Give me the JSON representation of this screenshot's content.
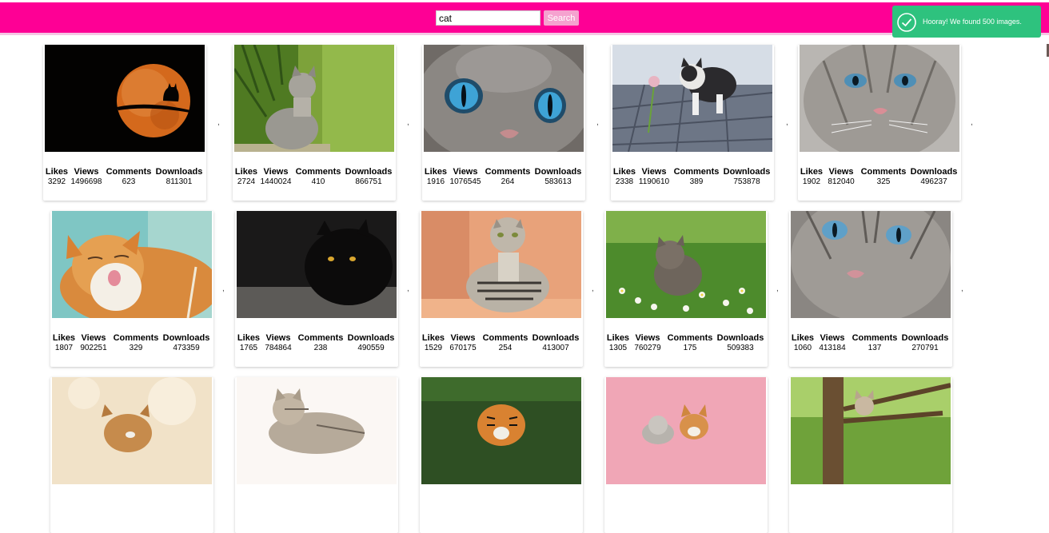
{
  "search": {
    "value": "cat",
    "button_label": "Search"
  },
  "toast": {
    "message": "Hooray! We found 500 images."
  },
  "separator": ",",
  "stat_labels": {
    "likes": "Likes",
    "views": "Views",
    "comments": "Comments",
    "downloads": "Downloads"
  },
  "images": [
    {
      "likes": "3292",
      "views": "1496698",
      "comments": "623",
      "downloads": "811301"
    },
    {
      "likes": "2724",
      "views": "1440024",
      "comments": "410",
      "downloads": "866751"
    },
    {
      "likes": "1916",
      "views": "1076545",
      "comments": "264",
      "downloads": "583613"
    },
    {
      "likes": "2338",
      "views": "1190610",
      "comments": "389",
      "downloads": "753878"
    },
    {
      "likes": "1902",
      "views": "812040",
      "comments": "325",
      "downloads": "496237"
    },
    {
      "likes": "1807",
      "views": "902251",
      "comments": "329",
      "downloads": "473359"
    },
    {
      "likes": "1765",
      "views": "784864",
      "comments": "238",
      "downloads": "490559"
    },
    {
      "likes": "1529",
      "views": "670175",
      "comments": "254",
      "downloads": "413007"
    },
    {
      "likes": "1305",
      "views": "760279",
      "comments": "175",
      "downloads": "509383"
    },
    {
      "likes": "1060",
      "views": "413184",
      "comments": "137",
      "downloads": "270791"
    }
  ]
}
